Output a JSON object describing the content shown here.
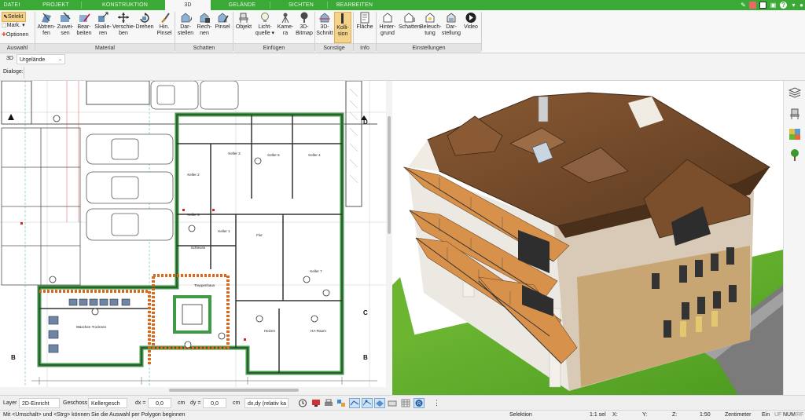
{
  "tabs": [
    "DATEI",
    "PROJEKT",
    "KONSTRUKTION",
    "3D",
    "GELÄNDE",
    "SICHTEN",
    "BEARBEITEN"
  ],
  "active_tab": "3D",
  "selection_tools": {
    "select": "Selekt",
    "mark": "Mark.",
    "options": "Optionen"
  },
  "ribbon": {
    "buttons": [
      {
        "l1": "Abtren-",
        "l2": "fen",
        "icon": "wall-split-icon"
      },
      {
        "l1": "Zuwei-",
        "l2": "sen",
        "icon": "assign-icon"
      },
      {
        "l1": "Bear-",
        "l2": "beiten",
        "icon": "edit-icon"
      },
      {
        "l1": "Skalie-",
        "l2": "ren",
        "icon": "scale-icon"
      },
      {
        "l1": "Verschie-",
        "l2": "ben",
        "icon": "move-icon"
      },
      {
        "l1": "Drehen",
        "l2": "",
        "icon": "rotate-icon"
      },
      {
        "l1": "Hin.",
        "l2": "Pinsel",
        "icon": "brush-icon"
      },
      {
        "l1": "Dar-",
        "l2": "stellen",
        "icon": "shadow-show-icon"
      },
      {
        "l1": "Rech-",
        "l2": "nen",
        "icon": "shadow-calc-icon"
      },
      {
        "l1": "Pinsel",
        "l2": "",
        "icon": "shadow-brush-icon"
      },
      {
        "l1": "Objekt",
        "l2": "",
        "icon": "chair-icon"
      },
      {
        "l1": "Licht-",
        "l2": "quelle ▾",
        "icon": "lightbulb-icon"
      },
      {
        "l1": "Kame-",
        "l2": "ra",
        "icon": "camera-icon"
      },
      {
        "l1": "3D-",
        "l2": "Bitmap",
        "icon": "tree-bitmap-icon"
      },
      {
        "l1": "3D-",
        "l2": "Schnitt",
        "icon": "section-icon"
      },
      {
        "l1": "Kolli-",
        "l2": "sion",
        "icon": "collision-icon"
      },
      {
        "l1": "Fläche",
        "l2": "",
        "icon": "area-icon"
      },
      {
        "l1": "Hinter-",
        "l2": "grund",
        "icon": "background-icon"
      },
      {
        "l1": "Schatten",
        "l2": "",
        "icon": "shadow-house-icon"
      },
      {
        "l1": "Beleuch-",
        "l2": "tung",
        "icon": "lighting-icon"
      },
      {
        "l1": "Dar-",
        "l2": "stellung",
        "icon": "display-icon"
      },
      {
        "l1": "Video",
        "l2": "",
        "icon": "video-play-icon"
      }
    ],
    "groups": [
      "Auswahl",
      "Material",
      "Schatten",
      "Einfügen",
      "Sonstige",
      "Info",
      "Einstellungen"
    ]
  },
  "row3d": {
    "view_label": "3D",
    "layer_combo": "Urgelände"
  },
  "dialog_label": "Dialoge:",
  "plan": {
    "rooms": [
      {
        "name": "Keller 5"
      },
      {
        "name": "Keller 4"
      },
      {
        "name": "Keller 2"
      },
      {
        "name": "Keller 3"
      },
      {
        "name": "Keller 6"
      },
      {
        "name": "Keller 1"
      },
      {
        "name": "Flur"
      },
      {
        "name": "Schleuse"
      },
      {
        "name": "Treppenhaus"
      },
      {
        "name": "Keller 7"
      },
      {
        "name": "Waschen Trocknen"
      },
      {
        "name": "Heizen"
      },
      {
        "name": "HA-Raum"
      }
    ],
    "section_marks": [
      "B",
      "C",
      "D",
      "B"
    ]
  },
  "controls": {
    "layer_label": "Layer :",
    "layer_value": "2D-Einricht",
    "floor_label": "Geschoss :",
    "floor_value": "Kellergesch",
    "dx_label": "dx =",
    "dx_value": "0,0",
    "dx_unit": "cm",
    "dy_label": "dy =",
    "dy_value": "0,0",
    "dy_unit": "cm",
    "mode_value": "dx,dy (relativ ka"
  },
  "status": {
    "hint": "Mit <Umschalt> und <Strg> können Sie die Auswahl per Polygon beginnen",
    "mode": "Selektion",
    "scale1": "1:1 sel",
    "x_label": "X:",
    "y_label": "Y:",
    "z_label": "Z:",
    "scale2": "1:50",
    "unit": "Zentimeter",
    "ein": "Ein",
    "uf": "UF",
    "num": "NUM",
    "rf": "RF"
  },
  "colors": {
    "ribbon_green": "#3aa935",
    "wall_green": "#3f9a45",
    "roof": "#7a4f2e",
    "balcony": "#d59045",
    "sky": "#ffffff",
    "grass": "#6dbb2c"
  }
}
